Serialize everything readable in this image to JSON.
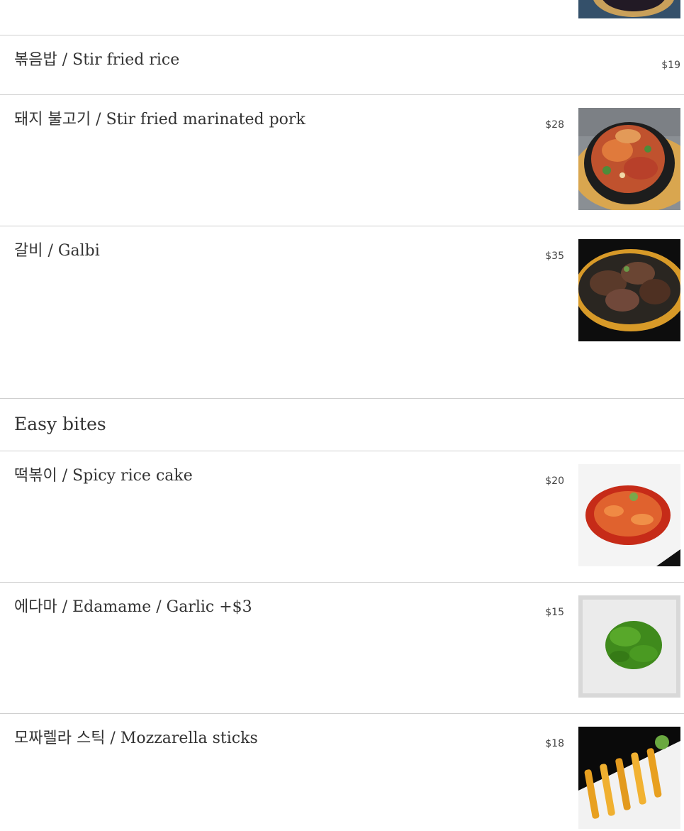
{
  "sections": [
    {
      "name": "",
      "items": [
        {
          "title": "볶음밥 / Stir fried rice",
          "price": "$19"
        },
        {
          "title": "돼지 불고기 / Stir fried marinated pork",
          "price": "$28"
        },
        {
          "title": "갈비 / Galbi",
          "price": "$35"
        }
      ]
    },
    {
      "name": "Easy bites",
      "items": [
        {
          "title": "떡볶이 / Spicy rice cake",
          "price": "$20"
        },
        {
          "title": "에다마 / Edamame / Garlic +$3",
          "price": "$15"
        },
        {
          "title": "모짜렐라 스틱 / Mozzarella sticks",
          "price": "$18"
        }
      ]
    }
  ]
}
